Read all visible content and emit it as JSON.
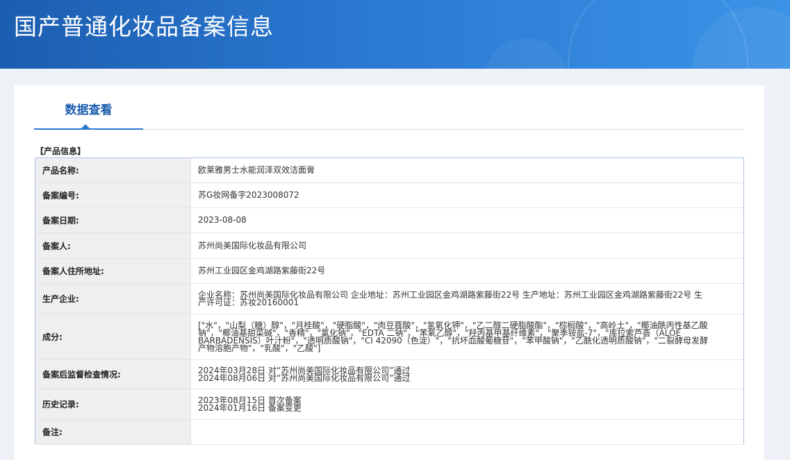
{
  "header": {
    "title": "国产普通化妆品备案信息"
  },
  "tabs": [
    {
      "label": "数据查看"
    }
  ],
  "section": {
    "title": "【产品信息】"
  },
  "rows": [
    {
      "label": "产品名称:",
      "value": "欧莱雅男士水能润泽双效洁面膏"
    },
    {
      "label": "备案编号:",
      "value": "苏G妆网备字2023008072"
    },
    {
      "label": "备案日期:",
      "value": "2023-08-08"
    },
    {
      "label": "备案人:",
      "value": "苏州尚美国际化妆品有限公司"
    },
    {
      "label": "备案人住所地址:",
      "value": "苏州工业园区金鸡湖路紫藤街22号"
    },
    {
      "label": "生产企业:",
      "value": "企业名称：苏州尚美国际化妆品有限公司 企业地址：苏州工业园区金鸡湖路紫藤街22号 生产地址：苏州工业园区金鸡湖路紫藤街22号 生产许可证：苏妆20160001"
    },
    {
      "label": "成分:",
      "value": "[\"水\"，\"山梨（糖）醇\"，\"月桂酸\"，\"硬脂酸\"，\"肉豆蔻酸\"，\"氢氧化钾\"，\"乙二醇二硬脂酸酯\"，\"棕榈酸\"，\"高岭土\"，\"椰油酰丙性基乙酸钠\"，\"椰油基甜菜碱\"，\"香精\"，\"氯化钠\"，\"EDTA 二钠\"，\"苯氧乙醇\"，\"羟丙基甲基纤维素\"，\"聚季铵盐-7\"，\"库拉索芦荟（ALOE BARBADENSIS）叶汁粉\"，\"透明质酸钠\"，\"CI 42090（色淀）\"，\"抗坏血酸葡糖苷\"，\"苯甲酸钠\"，\"乙酰化透明质酸钠\"，\"二裂酵母发酵产物溶胞产物\"，\"乳酸\"，\"乙酸\"]"
    },
    {
      "label": "备案后监督检查情况:",
      "value": "2024年03月28日 对“苏州尚美国际化妆品有限公司”通过\n2024年08月06日 对“苏州尚美国际化妆品有限公司”通过"
    },
    {
      "label": "历史记录:",
      "value": "2023年08月15日 首次备案\n2024年01月16日 备案变更"
    },
    {
      "label": "备注:",
      "value": ""
    }
  ]
}
